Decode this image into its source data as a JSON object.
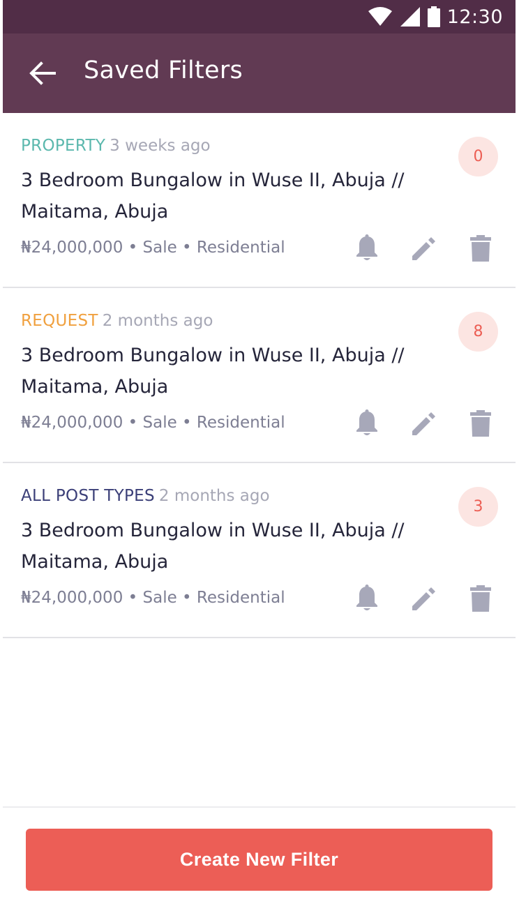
{
  "status_bar": {
    "time": "12:30",
    "icons": [
      "wifi-icon",
      "signal-icon",
      "battery-icon"
    ]
  },
  "app_bar": {
    "back_icon": "arrow-left-icon",
    "title": "Saved Filters"
  },
  "colors": {
    "status_bar": "#512d47",
    "app_bar": "#613a53",
    "accent": "#ec5e56",
    "property": "#4fb3a9",
    "request": "#f0a03e",
    "all_post_types": "#3b3f78",
    "icon_gray": "#a7a8b9"
  },
  "filters": [
    {
      "post_type": "PROPERTY",
      "post_type_color": "#5bb8ad",
      "time_ago": "3 weeks ago",
      "title": "3 Bedroom Bungalow in Wuse II, Abuja // Maitama, Abuja",
      "price_line": "₦24,000,000 • Sale • Residential",
      "count": "0",
      "actions": [
        "bell-icon",
        "pencil-icon",
        "trash-icon"
      ]
    },
    {
      "post_type": "REQUEST",
      "post_type_color": "#f0a03e",
      "time_ago": "2 months ago",
      "title": "3 Bedroom Bungalow in Wuse II, Abuja // Maitama, Abuja",
      "price_line": "₦24,000,000 • Sale • Residential",
      "count": "8",
      "actions": [
        "bell-icon",
        "pencil-icon",
        "trash-icon"
      ]
    },
    {
      "post_type": "ALL POST TYPES",
      "post_type_color": "#3b3f78",
      "time_ago": "2 months ago",
      "title": "3 Bedroom Bungalow in Wuse II, Abuja // Maitama, Abuja",
      "price_line": "₦24,000,000 • Sale • Residential",
      "count": "3",
      "actions": [
        "bell-icon",
        "pencil-icon",
        "trash-icon"
      ]
    }
  ],
  "footer": {
    "create_label": "Create New Filter"
  }
}
